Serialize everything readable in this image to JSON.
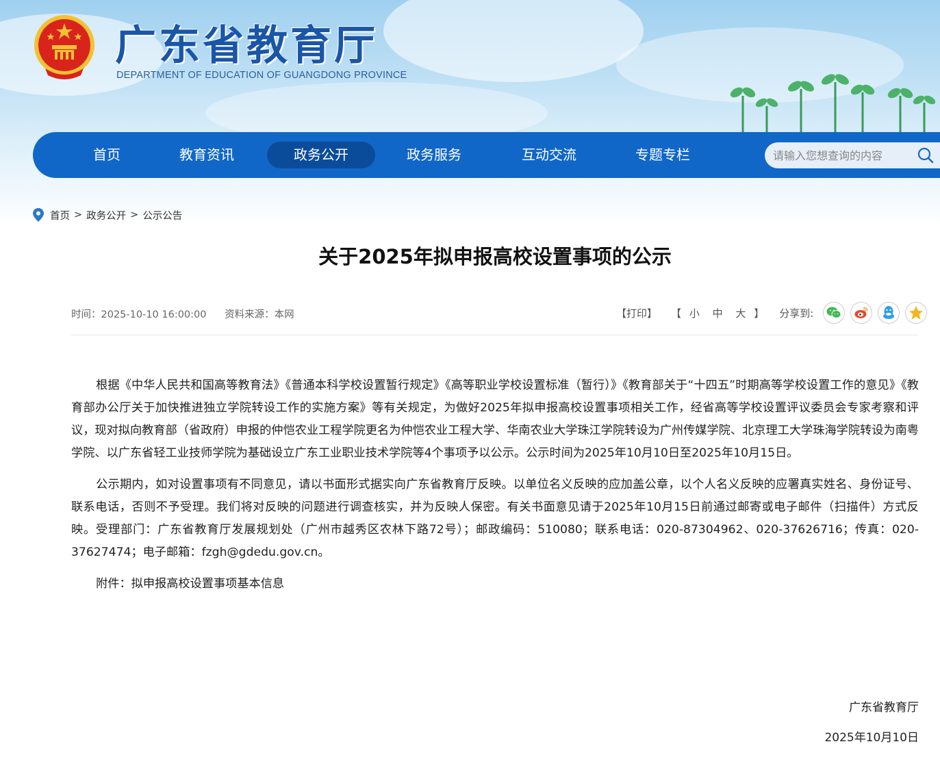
{
  "header": {
    "title": "广东省教育厅",
    "subtitle": "DEPARTMENT OF EDUCATION OF GUANGDONG PROVINCE"
  },
  "nav": {
    "items": [
      "首页",
      "教育资讯",
      "政务公开",
      "政务服务",
      "互动交流",
      "专题专栏"
    ],
    "active": "政务公开",
    "search_placeholder": "请输入您想查询的内容"
  },
  "breadcrumb": {
    "home": "首页",
    "level1": "政务公开",
    "level2": "公示公告",
    "separator": ">"
  },
  "article": {
    "title": "关于2025年拟申报高校设置事项的公示",
    "time": "时间：2025-10-10 16:00:00",
    "source": "资料来源：本网",
    "print_label": "【打印】",
    "font_open": "【",
    "font_small": "小",
    "font_medium": "中",
    "font_large": "大",
    "font_close": "】",
    "share_label": "分享到:",
    "share_icons": [
      "wechat-icon",
      "weibo-icon",
      "qq-icon",
      "qzone-icon"
    ],
    "paragraphs": [
      "根据《中华人民共和国高等教育法》《普通本科学校设置暂行规定》《高等职业学校设置标准（暂行）》《教育部关于“十四五”时期高等学校设置工作的意见》《教育部办公厅关于加快推进独立学院转设工作的实施方案》等有关规定，为做好2025年拟申报高校设置事项相关工作，经省高等学校设置评议委员会专家考察和评议，现对拟向教育部（省政府）申报的仲恺农业工程学院更名为仲恺农业工程大学、华南农业大学珠江学院转设为广州传媒学院、北京理工大学珠海学院转设为南粤学院、以广东省轻工业技师学院为基础设立广东工业职业技术学院等4个事项予以公示。公示时间为2025年10月10日至2025年10月15日。",
      "公示期内，如对设置事项有不同意见，请以书面形式据实向广东省教育厅反映。以单位名义反映的应加盖公章，以个人名义反映的应署真实姓名、身份证号、联系电话，否则不予受理。我们将对反映的问题进行调查核实，并为反映人保密。有关书面意见请于2025年10月15日前通过邮寄或电子邮件（扫描件）方式反映。受理部门：广东省教育厅发展规划处（广州市越秀区农林下路72号）；邮政编码：510080；联系电话：020-87304962、020-37626716；传真：020-37627474；电子邮箱：fzgh@gdedu.gov.cn。",
      "附件：拟申报高校设置事项基本信息"
    ],
    "signature_org": "广东省教育厅",
    "signature_date": "2025年10月10日"
  },
  "colors": {
    "nav_bg": "#1167c8",
    "nav_active": "#0b4c9a",
    "title_blue": "#1a56a8",
    "wechat": "#3fb950",
    "weibo": "#e6492d",
    "qq": "#2d9fe6",
    "qzone": "#f2b51a"
  }
}
